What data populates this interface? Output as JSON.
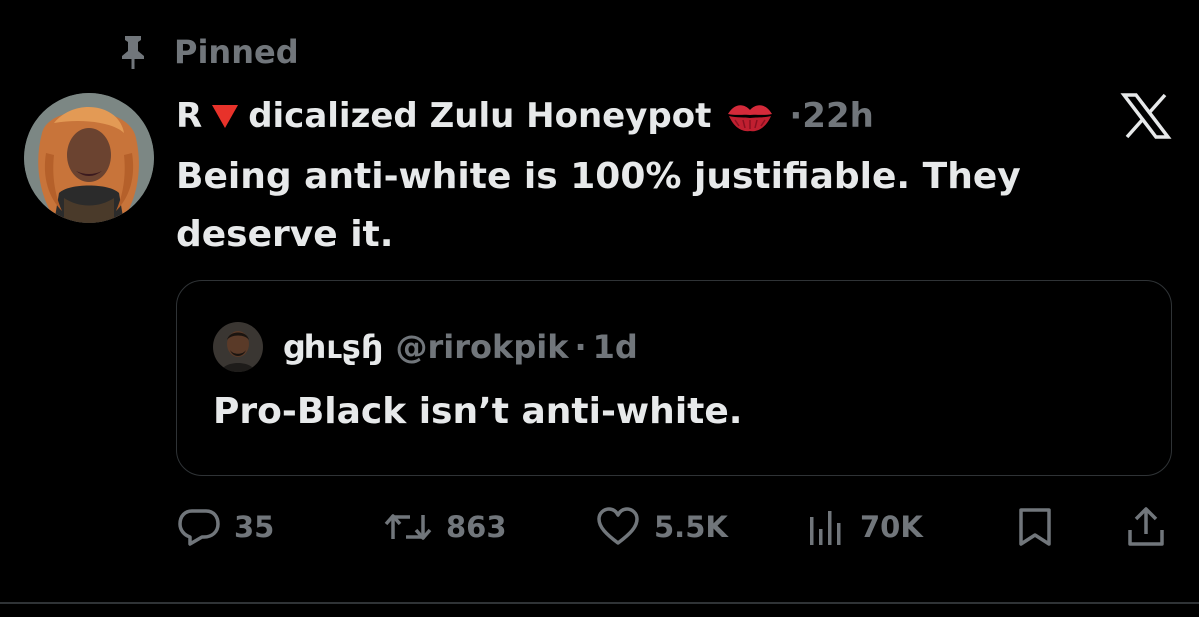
{
  "pinned": {
    "label": "Pinned"
  },
  "tweet": {
    "author_name_start": "R",
    "author_name_end": "dicalized Zulu Honeypot",
    "separator": "·",
    "time": "22h",
    "text": "Being anti-white is 100% justifiable. They deserve it."
  },
  "quote": {
    "author_name": "ցhւʂɧ",
    "handle": "@rirokpik",
    "separator": "·",
    "time": "1d",
    "text": "Pro-Black isn’t anti-white."
  },
  "actions": {
    "replies": "35",
    "reposts": "863",
    "likes": "5.5K",
    "views": "70K"
  },
  "colors": {
    "background": "#000000",
    "primary_text": "#e7e9ea",
    "secondary_text": "#71767b",
    "border": "#2f3336",
    "red_triangle": "#e8322a"
  },
  "icons": [
    "pin-icon",
    "red-triangle-icon",
    "kiss-mark-icon",
    "x-logo-icon",
    "reply-icon",
    "repost-icon",
    "like-icon",
    "views-icon",
    "bookmark-icon",
    "share-icon"
  ]
}
